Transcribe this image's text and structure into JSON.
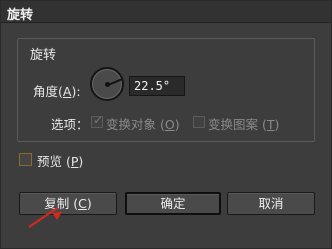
{
  "window": {
    "title": "旋转"
  },
  "group": {
    "title": "旋转"
  },
  "angle": {
    "label": "角度",
    "mnemonic": "A",
    "value": "22.5°"
  },
  "options": {
    "label": "选项：",
    "transform_objects": {
      "label": "变换对象",
      "mnemonic": "O",
      "checked": true,
      "enabled": false
    },
    "transform_patterns": {
      "label": "变换图案",
      "mnemonic": "T",
      "checked": false,
      "enabled": false
    }
  },
  "preview": {
    "label": "预览",
    "mnemonic": "P",
    "checked": false
  },
  "buttons": {
    "copy": {
      "label": "复制",
      "mnemonic": "C"
    },
    "ok": {
      "label": "确定"
    },
    "cancel": {
      "label": "取消"
    }
  },
  "colors": {
    "background": "#3d3d3d",
    "annotation_arrow": "#d8281e"
  }
}
